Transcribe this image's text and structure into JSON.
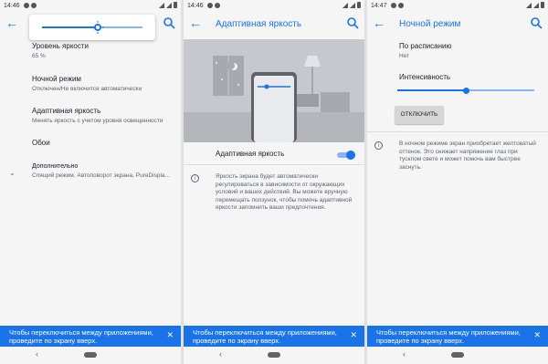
{
  "screens": [
    {
      "status_time": "14:46",
      "brightness_popup": {
        "level": 0.55
      },
      "settings": [
        {
          "title": "Уровень яркости",
          "subtitle": "65 %"
        },
        {
          "title": "Ночной режим",
          "subtitle": "Отключен/Не включится автоматически"
        },
        {
          "title": "Адаптивная яркость",
          "subtitle": "Менять яркость с учетом уровня освещенности"
        },
        {
          "title": "Обои",
          "subtitle": ""
        },
        {
          "title": "Дополнительно",
          "subtitle": "Спящий режим, Автоповорот экрана, PureDispla..."
        }
      ]
    },
    {
      "status_time": "14:46",
      "title": "Адаптивная яркость",
      "toggle_label": "Адаптивная яркость",
      "toggle_on": true,
      "info": "Яркость экрана будет автоматически регулироваться в зависимости от окружающих условий и ваших действий. Вы можете вручную перемещать ползунок, чтобы помочь адаптивной яркости запомнить ваши предпочтения."
    },
    {
      "status_time": "14:47",
      "title": "Ночной режим",
      "schedule_title": "По расписанию",
      "schedule_value": "Нет",
      "intensity_label": "Интенсивность",
      "intensity_level": 0.5,
      "button_label": "ОТКЛЮЧИТЬ",
      "info": "В ночном режиме экран приобретает желтоватый оттенок. Это снижает напряжение глаз при тусклом свете и может помочь вам быстрее заснуть."
    }
  ],
  "snackbar": {
    "text": "Чтобы переключиться между приложениями, проведите по экрану вверх.",
    "close": "✕"
  },
  "icons": {
    "back": "←",
    "nav_back": "‹",
    "chevron": "⌄",
    "info": "i"
  },
  "colors": {
    "accent": "#1a73e8",
    "track": "#8ab4f8"
  }
}
